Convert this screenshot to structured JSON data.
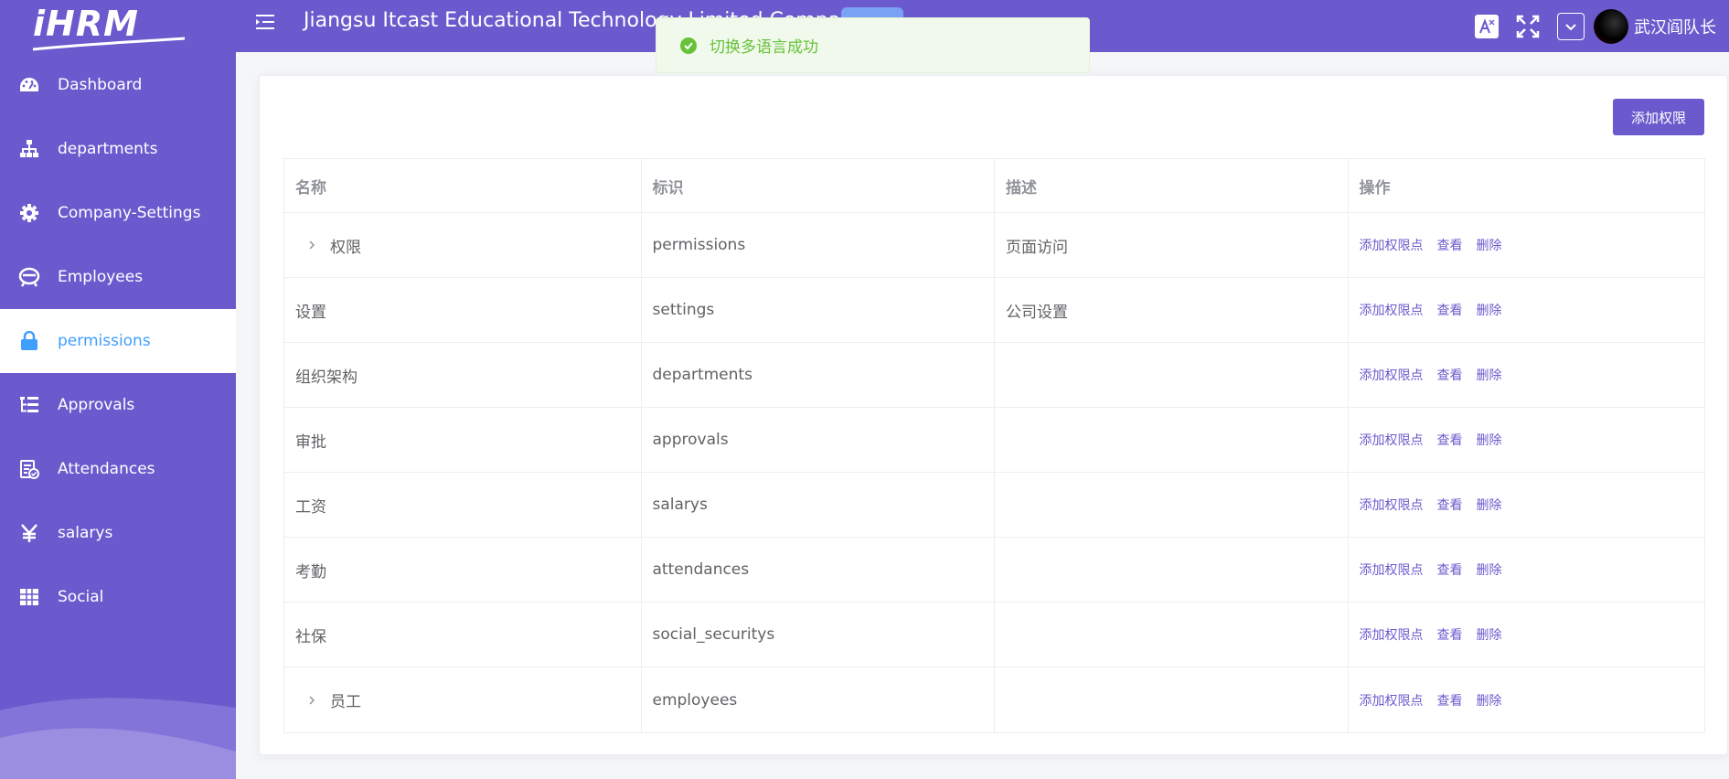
{
  "app": {
    "logo_text": "iHRM",
    "company_name": "Jiangsu Itcast Educational Technology Limited Company",
    "username": "武汉阎队长"
  },
  "sidebar": {
    "items": [
      {
        "label": "Dashboard",
        "icon": "dashboard-icon",
        "active": false
      },
      {
        "label": "departments",
        "icon": "tree-icon",
        "active": false
      },
      {
        "label": "Company-Settings",
        "icon": "gear-icon",
        "active": false
      },
      {
        "label": "Employees",
        "icon": "people-icon",
        "active": false
      },
      {
        "label": "permissions",
        "icon": "lock-icon",
        "active": true
      },
      {
        "label": "Approvals",
        "icon": "tree-table-icon",
        "active": false
      },
      {
        "label": "Attendances",
        "icon": "skill-icon",
        "active": false
      },
      {
        "label": "salarys",
        "icon": "money-icon",
        "active": false
      },
      {
        "label": "Social",
        "icon": "table-icon",
        "active": false
      }
    ]
  },
  "toast": {
    "message": "切换多语言成功",
    "type": "success"
  },
  "toolbar": {
    "add_permission_label": "添加权限"
  },
  "table": {
    "headers": [
      "名称",
      "标识",
      "描述",
      "操作"
    ],
    "rows": [
      {
        "name": "权限",
        "code": "permissions",
        "desc": "页面访问",
        "expandable": true
      },
      {
        "name": "设置",
        "code": "settings",
        "desc": "公司设置",
        "expandable": false
      },
      {
        "name": "组织架构",
        "code": "departments",
        "desc": "",
        "expandable": false
      },
      {
        "name": "审批",
        "code": "approvals",
        "desc": "",
        "expandable": false
      },
      {
        "name": "工资",
        "code": "salarys",
        "desc": "",
        "expandable": false
      },
      {
        "name": "考勤",
        "code": "attendances",
        "desc": "",
        "expandable": false
      },
      {
        "name": "社保",
        "code": "social_securitys",
        "desc": "",
        "expandable": false
      },
      {
        "name": "员工",
        "code": "employees",
        "desc": "",
        "expandable": true
      }
    ],
    "actions": {
      "add_point": "添加权限点",
      "view": "查看",
      "delete": "删除"
    }
  },
  "colors": {
    "primary": "#6a5acd",
    "active_text": "#409eff",
    "success": "#67c23a"
  }
}
